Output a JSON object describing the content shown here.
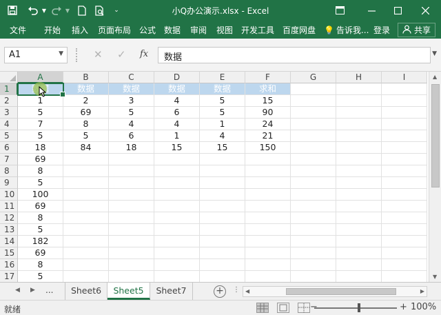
{
  "window": {
    "title": "小Q办公演示.xlsx - Excel"
  },
  "ribbon": {
    "tabs": [
      "文件",
      "开始",
      "插入",
      "页面布局",
      "公式",
      "数据",
      "审阅",
      "视图",
      "开发工具",
      "百度网盘"
    ],
    "tell_me": "告诉我...",
    "login": "登录",
    "share": "共享"
  },
  "formula_bar": {
    "name_box": "A1",
    "formula": "数据",
    "fx": "fx"
  },
  "grid": {
    "columns": [
      "A",
      "B",
      "C",
      "D",
      "E",
      "F",
      "G",
      "H",
      "I"
    ],
    "rows": [
      "1",
      "2",
      "3",
      "4",
      "5",
      "6",
      "7",
      "8",
      "9",
      "10",
      "11",
      "12",
      "13",
      "14",
      "15",
      "16",
      "17"
    ],
    "cells": [
      [
        "数据",
        "数据",
        "数据",
        "数据",
        "数据",
        "求和"
      ],
      [
        "1",
        "2",
        "3",
        "4",
        "5",
        "15"
      ],
      [
        "5",
        "69",
        "5",
        "6",
        "5",
        "90"
      ],
      [
        "7",
        "8",
        "4",
        "4",
        "1",
        "24"
      ],
      [
        "5",
        "5",
        "6",
        "1",
        "4",
        "21"
      ],
      [
        "18",
        "84",
        "18",
        "15",
        "15",
        "150"
      ],
      [
        "69"
      ],
      [
        "8"
      ],
      [
        "5"
      ],
      [
        "100"
      ],
      [
        "69"
      ],
      [
        "8"
      ],
      [
        "5"
      ],
      [
        "182"
      ],
      [
        "69"
      ],
      [
        "8"
      ],
      [
        "5"
      ]
    ],
    "selected_cell": "A1"
  },
  "sheets": {
    "ellipsis": "...",
    "tabs": [
      "Sheet6",
      "Sheet5",
      "Sheet7"
    ],
    "active": "Sheet5"
  },
  "status": {
    "ready": "就绪",
    "zoom": "100%",
    "zoom_minus": "−",
    "zoom_plus": "+"
  },
  "colors": {
    "accent": "#217346",
    "header_fill": "#bdd7ee"
  }
}
